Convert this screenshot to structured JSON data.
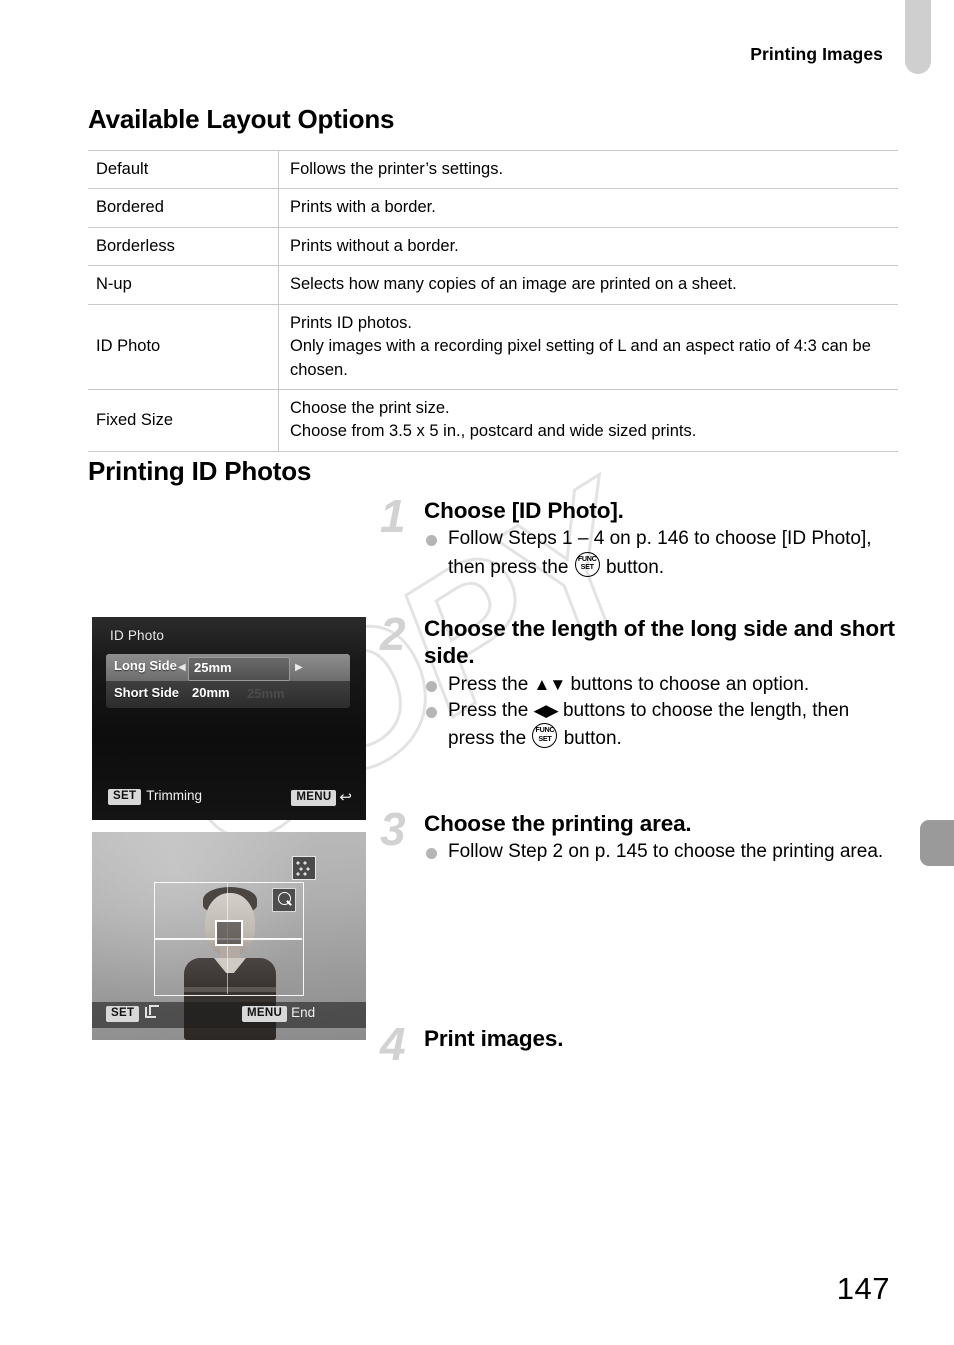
{
  "running_head": "Printing Images",
  "page_number": "147",
  "watermark": "COPY",
  "sections": {
    "layout_options_heading": "Available Layout Options",
    "id_photos_heading": "Printing ID Photos"
  },
  "layout_table": {
    "rows": [
      {
        "name": "Default",
        "lines": [
          "Follows the printer’s settings."
        ]
      },
      {
        "name": "Bordered",
        "lines": [
          "Prints with a border."
        ]
      },
      {
        "name": "Borderless",
        "lines": [
          "Prints without a border."
        ]
      },
      {
        "name": "N-up",
        "lines": [
          "Selects how many copies of an image are printed on a sheet."
        ]
      },
      {
        "name": "ID Photo",
        "lines": [
          "Prints ID photos.",
          "Only images with a recording pixel setting of L and an aspect ratio of 4:3 can be chosen."
        ]
      },
      {
        "name": "Fixed Size",
        "lines": [
          "Choose the print size.",
          "Choose from 3.5 x 5 in., postcard and wide sized prints."
        ]
      }
    ]
  },
  "steps": [
    {
      "number": "1",
      "title": "Choose [ID Photo].",
      "bullets": [
        {
          "pre": "Follow Steps 1 – 4 on p. 146 to choose [ID Photo], then press the ",
          "icon": "funcset-button-icon",
          "post": " button."
        }
      ]
    },
    {
      "number": "2",
      "title": "Choose the length of the long side and short side.",
      "bullets": [
        {
          "pre": "Press the ",
          "icon": "up-down-buttons-icon",
          "glyph": "▲▼",
          "post": " buttons to choose an option."
        },
        {
          "pre": "Press the ",
          "icon": "left-right-buttons-icon",
          "glyph": "◀▶",
          "mid": " buttons to choose the length, then press the ",
          "icon2": "funcset-button-icon",
          "post": " button."
        }
      ]
    },
    {
      "number": "3",
      "title": "Choose the printing area.",
      "bullets": [
        {
          "pre": "Follow Step 2 on p. 145 to choose the printing area."
        }
      ]
    },
    {
      "number": "4",
      "title": "Print images.",
      "bullets": []
    }
  ],
  "lcd_screen_1": {
    "title": "ID Photo",
    "rows": [
      {
        "label": "Long Side",
        "value": "25mm",
        "selected": true,
        "left_arrow": "◀",
        "right_arrow": "▶"
      },
      {
        "label": "Short Side",
        "value": "20mm",
        "selected": false,
        "ghost_value": "25mm"
      }
    ],
    "footer": {
      "set_badge": "SET",
      "set_label": "Trimming",
      "menu_badge": "MENU",
      "menu_label": "↩"
    }
  },
  "lcd_screen_2": {
    "icons": [
      "resolution-icon",
      "magnify-icon"
    ],
    "footer": {
      "set_badge": "SET",
      "set_label": "crop-rotate-icon",
      "menu_badge": "MENU",
      "menu_label": "End"
    }
  },
  "funcset_icon": {
    "top": "FUNC",
    "bottom": "SET"
  },
  "colors": {
    "rule": "#c9c9c9",
    "step_number": "#d2d2d2",
    "bullet": "#b5b5b5",
    "watermark": "#e3e3e3",
    "tab_top": "#cfcfcf",
    "tab_mid": "#9a9a9a"
  }
}
